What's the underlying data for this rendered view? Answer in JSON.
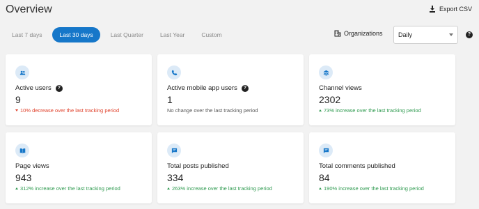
{
  "header": {
    "title": "Overview",
    "export_label": "Export CSV"
  },
  "tabs": [
    {
      "label": "Last 7 days",
      "active": false
    },
    {
      "label": "Last 30 days",
      "active": true
    },
    {
      "label": "Last Quarter",
      "active": false
    },
    {
      "label": "Last Year",
      "active": false
    },
    {
      "label": "Custom",
      "active": false
    }
  ],
  "filters": {
    "organizations_label": "Organizations",
    "period_select_value": "Daily",
    "help_symbol": "?"
  },
  "colors": {
    "accent": "#1677c9",
    "increase": "#2e9a4f",
    "decrease": "#e0412b",
    "icon_bg": "#dceaf7"
  },
  "cards": [
    {
      "icon": "users-icon",
      "label": "Active users",
      "help": "?",
      "value": "9",
      "trend": "down",
      "change": "10% decrease over the last tracking period"
    },
    {
      "icon": "phone-icon",
      "label": "Active mobile app users",
      "help": "?",
      "value": "1",
      "trend": "none",
      "change": "No change over the last tracking period"
    },
    {
      "icon": "layers-icon",
      "label": "Channel views",
      "value": "2302",
      "trend": "up",
      "change": "73% increase over the last tracking period"
    },
    {
      "icon": "book-icon",
      "label": "Page views",
      "value": "943",
      "trend": "up",
      "change": "312% increase over the last tracking period"
    },
    {
      "icon": "message-icon",
      "label": "Total posts published",
      "value": "334",
      "trend": "up",
      "change": "263% increase over the last tracking period"
    },
    {
      "icon": "message-icon",
      "label": "Total comments published",
      "value": "84",
      "trend": "up",
      "change": "190% increase over the last tracking period"
    }
  ]
}
